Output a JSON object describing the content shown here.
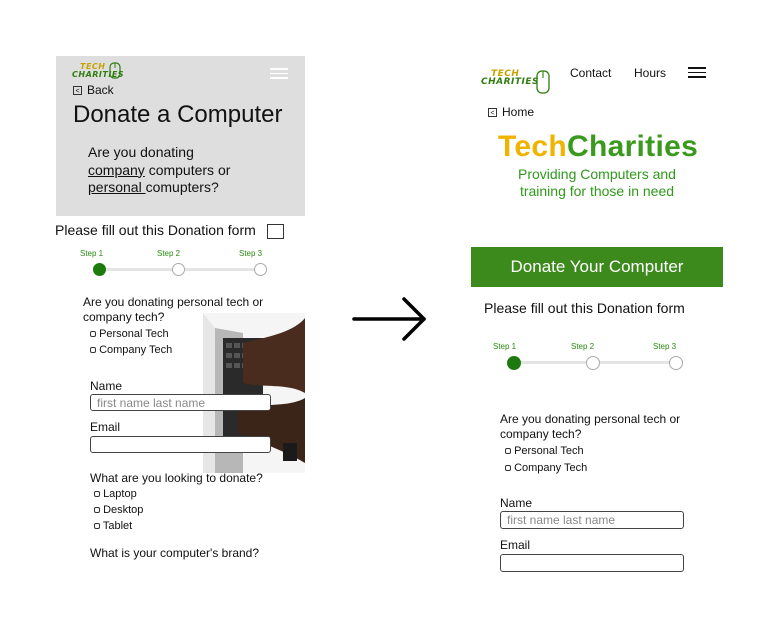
{
  "left": {
    "logo": {
      "line1": "TECH",
      "line2": "CHARITIES"
    },
    "back_label": "Back",
    "title": "Donate a Computer",
    "question_prefix": "Are you donating",
    "question_company": "company",
    "question_mid": " computers or",
    "question_personal": "personal ",
    "question_suffix": "comupters?",
    "form_title": "Please fill out this Donation form",
    "steps": [
      "Step 1",
      "Step 2",
      "Step 3"
    ],
    "tech_question": "Are you donating personal tech or company tech?",
    "tech_options": [
      "Personal Tech",
      "Company Tech"
    ],
    "name_label": "Name",
    "name_placeholder": "first name last name",
    "email_label": "Email",
    "donate_question": "What are you looking to donate?",
    "donate_options": [
      "Laptop",
      "Desktop",
      "Tablet"
    ],
    "brand_question": "What is your computer's brand?"
  },
  "right": {
    "logo": {
      "line1": "TECH",
      "line2": "CHARITIES"
    },
    "nav": [
      "Contact",
      "Hours"
    ],
    "home_label": "Home",
    "brand_tech": "Tech",
    "brand_charities": "Charities",
    "tagline_1": "Providing Computers and",
    "tagline_2": "training for those in need",
    "banner": "Donate Your Computer",
    "form_title": "Please fill out this Donation form",
    "steps": [
      "Step 1",
      "Step 2",
      "Step 3"
    ],
    "tech_question": "Are you donating personal tech or company tech?",
    "tech_options": [
      "Personal Tech",
      "Company Tech"
    ],
    "name_label": "Name",
    "name_placeholder": "first name last name",
    "email_label": "Email"
  },
  "colors": {
    "green": "#3c8a1c",
    "gold": "#f0b400",
    "brand_green": "#3a9a1e"
  }
}
